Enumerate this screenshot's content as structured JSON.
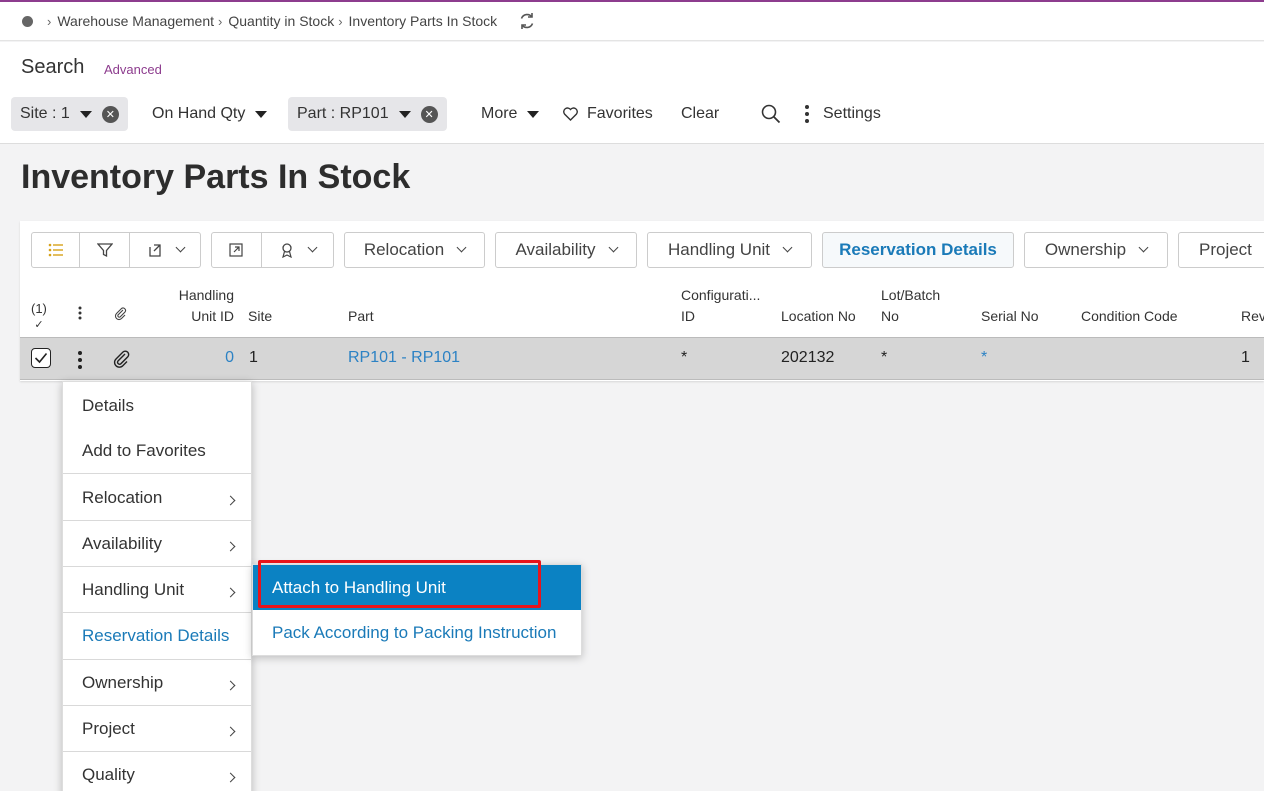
{
  "breadcrumb": {
    "items": [
      "Warehouse Management",
      "Quantity in Stock",
      "Inventory Parts In Stock"
    ]
  },
  "search": {
    "title": "Search",
    "advanced": "Advanced",
    "filters": {
      "site": "Site : 1",
      "on_hand": "On Hand Qty",
      "part": "Part : RP101",
      "more": "More"
    },
    "favorites": "Favorites",
    "clear": "Clear",
    "settings": "Settings"
  },
  "page_title": "Inventory Parts In Stock",
  "toolbar": {
    "relocation": "Relocation",
    "availability": "Availability",
    "handling_unit": "Handling Unit",
    "reservation_details": "Reservation Details",
    "ownership": "Ownership",
    "project": "Project"
  },
  "table": {
    "selected_count": "(1)",
    "headers": {
      "handling_unit_id_1": "Handling",
      "handling_unit_id_2": "Unit ID",
      "site": "Site",
      "part": "Part",
      "config_1": "Configurati...",
      "config_2": "ID",
      "location_no": "Location No",
      "lot_batch_1": "Lot/Batch",
      "lot_batch_2": "No",
      "serial_no": "Serial No",
      "condition_code": "Condition Code",
      "rev": "Rev"
    },
    "row": {
      "handling_unit_id": "0",
      "site": "1",
      "part": "RP101 - RP101",
      "config_id": "*",
      "location_no": "202132",
      "lot_batch_no": "*",
      "serial_no": "*",
      "rev": "1"
    }
  },
  "context_menu": {
    "details": "Details",
    "add_to_favorites": "Add to Favorites",
    "relocation": "Relocation",
    "availability": "Availability",
    "handling_unit": "Handling Unit",
    "reservation_details": "Reservation Details",
    "ownership": "Ownership",
    "project": "Project",
    "quality": "Quality"
  },
  "submenu": {
    "attach": "Attach to Handling Unit",
    "pack": "Pack According to Packing Instruction"
  },
  "colors": {
    "brand": "#8d3c8e",
    "accent": "#1a7ab8",
    "active": "#0b82c3",
    "highlight": "#e8141b"
  }
}
